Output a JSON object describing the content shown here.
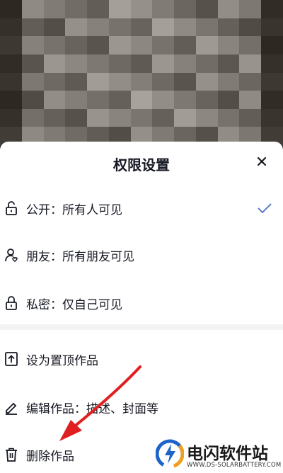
{
  "sheet": {
    "title": "权限设置",
    "close_icon": "close-icon",
    "options": [
      {
        "label": "公开：所有人可见",
        "icon": "unlock-icon",
        "selected": true
      },
      {
        "label": "朋友：所有朋友可见",
        "icon": "friend-icon",
        "selected": false
      },
      {
        "label": "私密：仅自己可见",
        "icon": "lock-icon",
        "selected": false
      }
    ],
    "actions": [
      {
        "label": "设为置顶作品",
        "icon": "pin-top-icon"
      },
      {
        "label": "编辑作品：描述、封面等",
        "icon": "edit-icon"
      },
      {
        "label": "删除作品",
        "icon": "trash-icon"
      }
    ],
    "accent_color": "#5a79c9"
  },
  "watermark": {
    "name": "电闪软件站",
    "url": "WWW.DS-SOLARBATTERY.COM"
  }
}
